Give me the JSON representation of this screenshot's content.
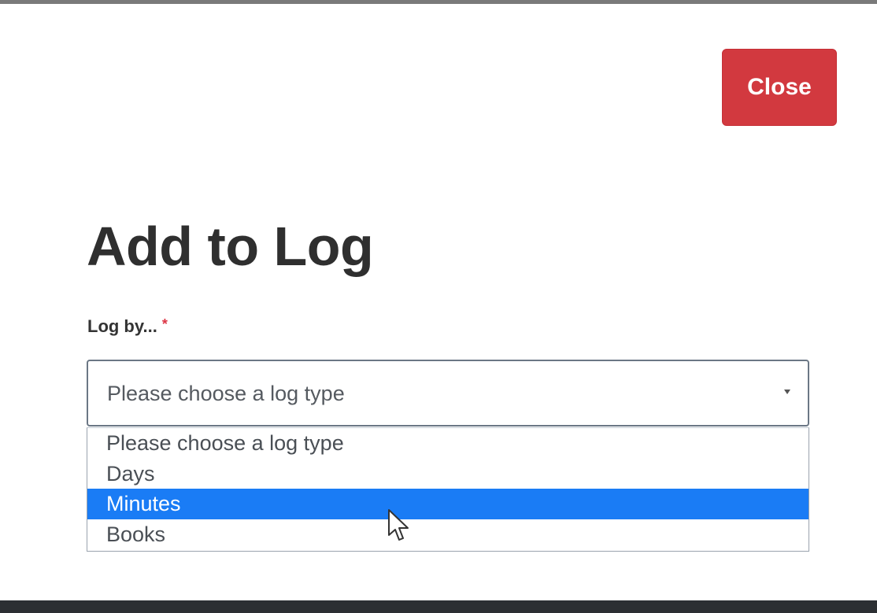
{
  "modal": {
    "close_label": "Close",
    "title": "Add to Log"
  },
  "field": {
    "label": "Log by...",
    "required_mark": "*",
    "selected_value": "Please choose a log type"
  },
  "dropdown": {
    "options": [
      {
        "label": "Please choose a log type",
        "highlighted": false
      },
      {
        "label": "Days",
        "highlighted": false
      },
      {
        "label": "Minutes",
        "highlighted": true
      },
      {
        "label": "Books",
        "highlighted": false
      }
    ]
  },
  "colors": {
    "close_button": "#d2393f",
    "option_highlight": "#1a7cf5",
    "required": "#dc3545"
  },
  "icons": {
    "caret": "chevron-down-icon",
    "cursor": "mouse-pointer-icon"
  }
}
